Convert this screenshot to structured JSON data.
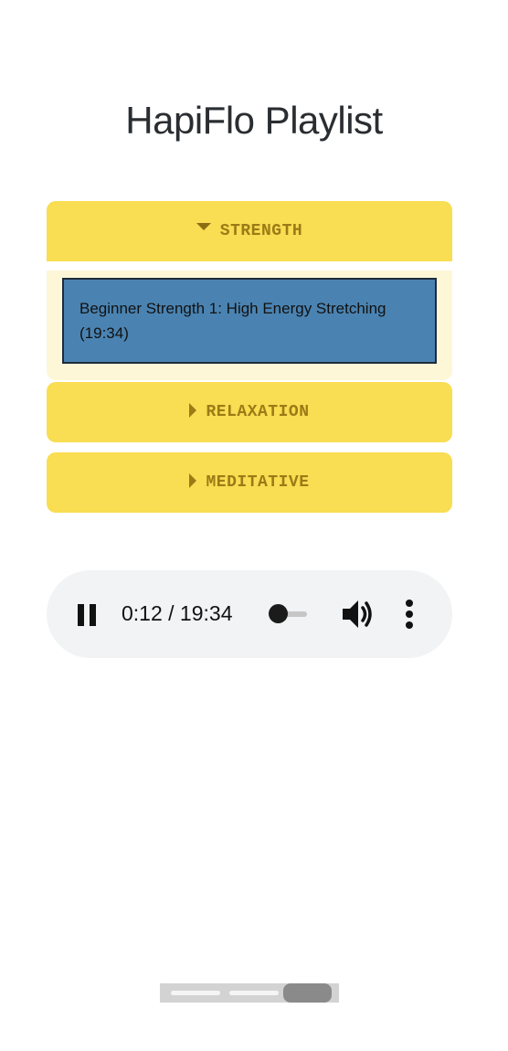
{
  "page": {
    "title": "HapiFlo Playlist"
  },
  "playlist": {
    "sections": [
      {
        "label": "STRENGTH",
        "expanded": true,
        "tracks": [
          {
            "title": "Beginner Strength 1: High Energy Stretching (19:34)"
          }
        ]
      },
      {
        "label": "RELAXATION",
        "expanded": false
      },
      {
        "label": "MEDITATIVE",
        "expanded": false
      }
    ]
  },
  "player": {
    "time_display": "0:12 / 19:34",
    "state": "playing",
    "progress_fraction": 0.01,
    "icons": {
      "play_pause": "pause-icon",
      "volume": "volume-icon",
      "more": "more-vert-icon"
    }
  },
  "colors": {
    "section_header": "#f9dd52",
    "section_label": "#9b7b16",
    "section_body": "#fdf7d8",
    "track_background": "#4a83b1",
    "player_background": "#f1f3f4"
  }
}
